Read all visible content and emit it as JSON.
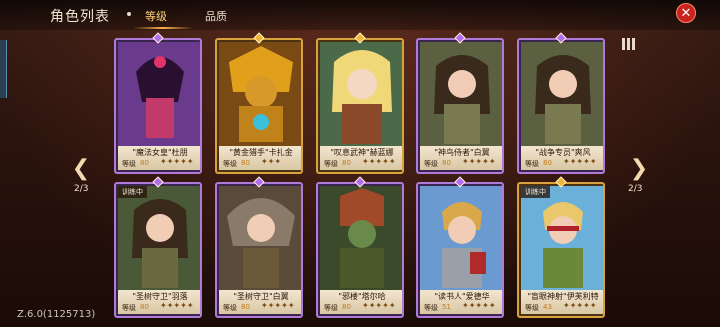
{
  "header": {
    "title": "角色列表",
    "tabs": [
      {
        "label": "等级",
        "active": true
      },
      {
        "label": "品质",
        "active": false
      }
    ],
    "close_icon": "close-icon"
  },
  "pagination": {
    "left_page": "2/3",
    "right_page": "2/3"
  },
  "version": "Z.6.0(1125713)",
  "colors": {
    "accent": "#ffb24d",
    "close": "#c8231c",
    "purple_rarity": "#b07ad8",
    "gold_rarity": "#d8a23c"
  },
  "level_label": "等级",
  "cards": [
    {
      "name": "\"魔法女皇\"杜朋",
      "level": "80",
      "stars": "✦✦✦✦✦",
      "badge": "",
      "rarity": "purple"
    },
    {
      "name": "\"黄金猎手\"卡扎金",
      "level": "80",
      "stars": "✦✦✦",
      "badge": "",
      "rarity": "gold"
    },
    {
      "name": "\"叹息武神\"赫蓝娜",
      "level": "80",
      "stars": "✦✦✦✦✦",
      "badge": "",
      "rarity": "gold"
    },
    {
      "name": "\"神鸟侍者\"白翼",
      "level": "80",
      "stars": "✦✦✦✦✦",
      "badge": "",
      "rarity": "purple"
    },
    {
      "name": "\"战争专员\"爽风",
      "level": "80",
      "stars": "✦✦✦✦✦",
      "badge": "",
      "rarity": "purple"
    },
    {
      "name": "\"圣树守卫\"羽落",
      "level": "80",
      "stars": "✦✦✦✦✦",
      "badge": "训练中",
      "rarity": "purple"
    },
    {
      "name": "\"圣树守卫\"白翼",
      "level": "80",
      "stars": "✦✦✦✦✦",
      "badge": "",
      "rarity": "purple"
    },
    {
      "name": "\"邪楼\"塔尔哈",
      "level": "80",
      "stars": "✦✦✦✦✦",
      "badge": "",
      "rarity": "purple"
    },
    {
      "name": "\"读书人\"爱德华",
      "level": "51",
      "stars": "✦✦✦✦✦",
      "badge": "",
      "rarity": "purple"
    },
    {
      "name": "\"盲眼神射\"伊芙利特",
      "level": "43",
      "stars": "✦✦✦✦✦",
      "badge": "训练中",
      "rarity": "gold"
    }
  ]
}
